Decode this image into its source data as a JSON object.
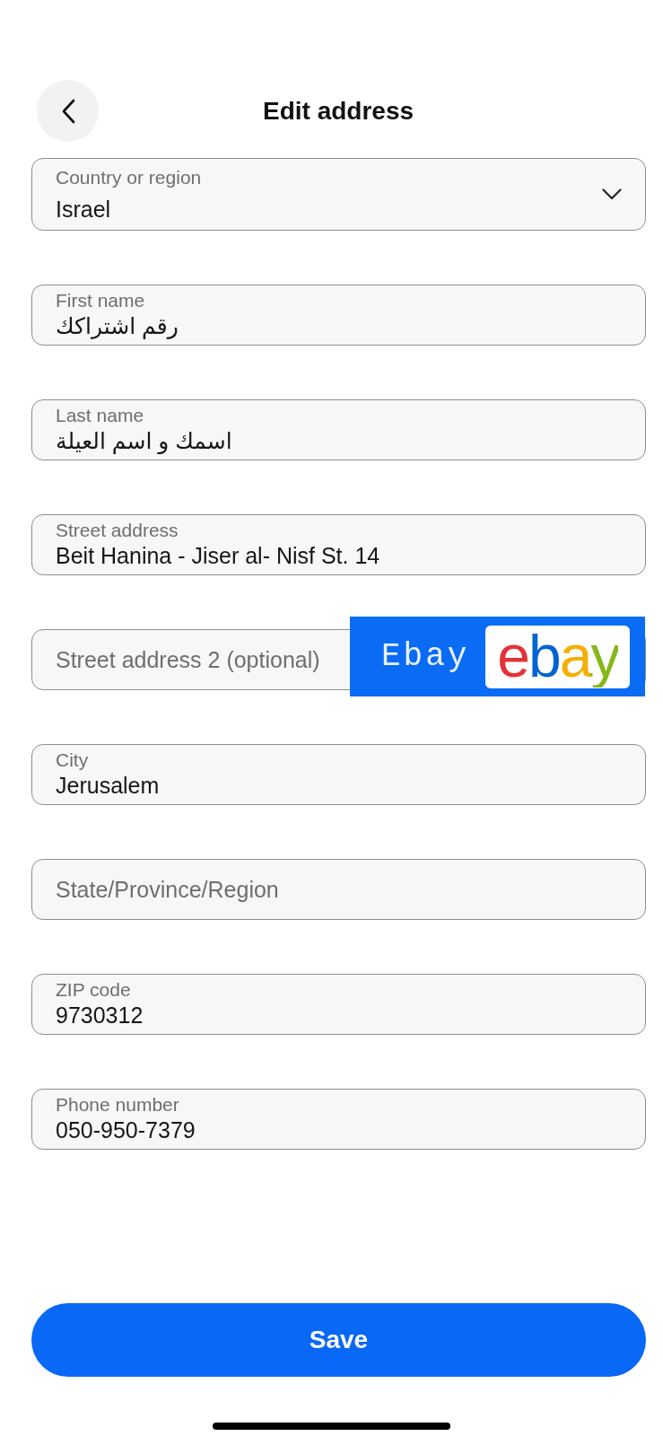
{
  "header": {
    "title": "Edit address"
  },
  "fields": [
    {
      "kind": "select",
      "label": "Country or region",
      "value": "Israel"
    },
    {
      "kind": "text",
      "label": "First name",
      "value": "رقم اشتراكك"
    },
    {
      "kind": "text",
      "label": "Last name",
      "value": "اسمك و اسم العيلة"
    },
    {
      "kind": "text",
      "label": "Street address",
      "value": "Beit Hanina - Jiser al- Nisf St. 14"
    },
    {
      "kind": "text",
      "placeholder": "Street address 2 (optional)",
      "overlay": {
        "caption": "Ebay",
        "logo": "ebay"
      }
    },
    {
      "kind": "text",
      "label": "City",
      "value": "Jerusalem"
    },
    {
      "kind": "text",
      "placeholder": "State/Province/Region"
    },
    {
      "kind": "text",
      "label": "ZIP code",
      "value": "9730312"
    },
    {
      "kind": "text",
      "label": "Phone number",
      "value": "050-950-7379"
    }
  ],
  "save_button": {
    "label": "Save"
  }
}
